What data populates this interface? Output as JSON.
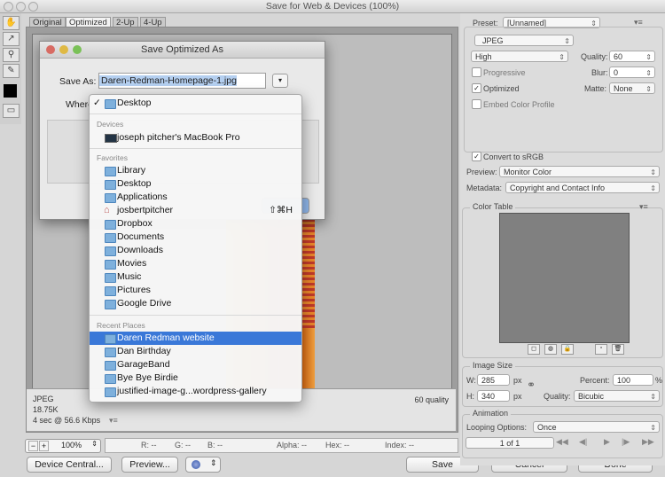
{
  "window": {
    "title": "Save for Web & Devices (100%)"
  },
  "tabs": [
    "Original",
    "Optimized",
    "2-Up",
    "4-Up"
  ],
  "preview": {
    "format": "JPEG",
    "size": "18.75K",
    "time": "4 sec @ 56.6 Kbps",
    "quality": "60 quality"
  },
  "bottom": {
    "zoom": "100%",
    "r": "R: --",
    "g": "G: --",
    "b": "B: --",
    "alpha": "Alpha: --",
    "hex": "Hex: --",
    "index": "Index: --",
    "device_central": "Device Central...",
    "preview_btn": "Preview...",
    "save": "Save",
    "cancel": "Cancel",
    "done": "Done"
  },
  "settings": {
    "preset_label": "Preset:",
    "preset_value": "[Unnamed]",
    "format": "JPEG",
    "quality_level": "High",
    "quality_label": "Quality:",
    "quality_value": "60",
    "blur_label": "Blur:",
    "blur_value": "0",
    "matte_label": "Matte:",
    "matte_value": "None",
    "progressive": "Progressive",
    "optimized": "Optimized",
    "embed_profile": "Embed Color Profile",
    "convert_srgb": "Convert to sRGB",
    "preview_label": "Preview:",
    "preview_value": "Monitor Color",
    "metadata_label": "Metadata:",
    "metadata_value": "Copyright and Contact Info"
  },
  "color_table": {
    "title": "Color Table"
  },
  "image_size": {
    "title": "Image Size",
    "w_label": "W:",
    "w_value": "285",
    "h_label": "H:",
    "h_value": "340",
    "unit": "px",
    "percent_label": "Percent:",
    "percent_value": "100",
    "percent_unit": "%",
    "quality_label": "Quality:",
    "quality_value": "Bicubic"
  },
  "animation": {
    "title": "Animation",
    "looping_label": "Looping Options:",
    "looping_value": "Once",
    "frame": "1 of 1"
  },
  "dialog": {
    "title": "Save Optimized As",
    "save_as_label": "Save As:",
    "filename": "Daren-Redman-Homepage-1.jpg",
    "where_label": "Where"
  },
  "menu": {
    "current": "Desktop",
    "devices_header": "Devices",
    "devices": [
      "joseph pitcher's MacBook Pro"
    ],
    "favorites_header": "Favorites",
    "favorites": [
      "Library",
      "Desktop",
      "Applications",
      "josbertpitcher",
      "Dropbox",
      "Documents",
      "Downloads",
      "Movies",
      "Music",
      "Pictures",
      "Google Drive"
    ],
    "shortcut": "⇧⌘H",
    "recent_header": "Recent Places",
    "recent": [
      "Daren Redman website",
      "Dan Birthday",
      "GarageBand",
      "Bye Bye Birdie",
      "justified-image-g...wordpress-gallery"
    ]
  }
}
